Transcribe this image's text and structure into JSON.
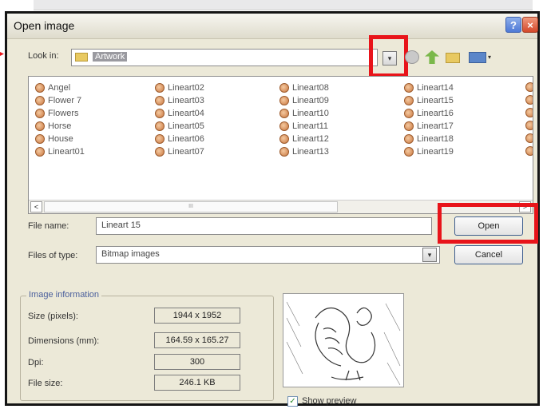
{
  "window": {
    "title": "Open image",
    "help_symbol": "?",
    "close_symbol": "×"
  },
  "look_in": {
    "label": "Look in:",
    "folder": "Artwork",
    "dropdown_symbol": "▾"
  },
  "toolbar": {
    "views_caret": "▾"
  },
  "files": [
    "Angel",
    "Flower 7",
    "Flowers",
    "Horse",
    "House",
    "Lineart01",
    "Lineart02",
    "Lineart03",
    "Lineart04",
    "Lineart05",
    "Lineart06",
    "Lineart07",
    "Lineart08",
    "Lineart09",
    "Lineart10",
    "Lineart11",
    "Lineart12",
    "Lineart13",
    "Lineart14",
    "Lineart15",
    "Lineart16",
    "Lineart17",
    "Lineart18",
    "Lineart19"
  ],
  "scrollbar": {
    "left": "<",
    "right": ">",
    "thumb_grip": "III"
  },
  "file_name": {
    "label": "File name:",
    "value": "Lineart 15"
  },
  "file_type": {
    "label": "Files of type:",
    "value": "Bitmap images"
  },
  "buttons": {
    "open": "Open",
    "cancel": "Cancel"
  },
  "image_info": {
    "title": "Image information",
    "size_label": "Size (pixels):",
    "size_value": "1944 x 1952",
    "dimensions_label": "Dimensions (mm):",
    "dimensions_value": "164.59 x 165.27",
    "dpi_label": "Dpi:",
    "dpi_value": "300",
    "filesize_label": "File size:",
    "filesize_value": "246.1 KB"
  },
  "preview": {
    "show_label": "Show preview",
    "checked_symbol": "✓",
    "checked": true
  },
  "colors": {
    "highlight": "#e8141a",
    "dialog_bg": "#ece9d8"
  }
}
